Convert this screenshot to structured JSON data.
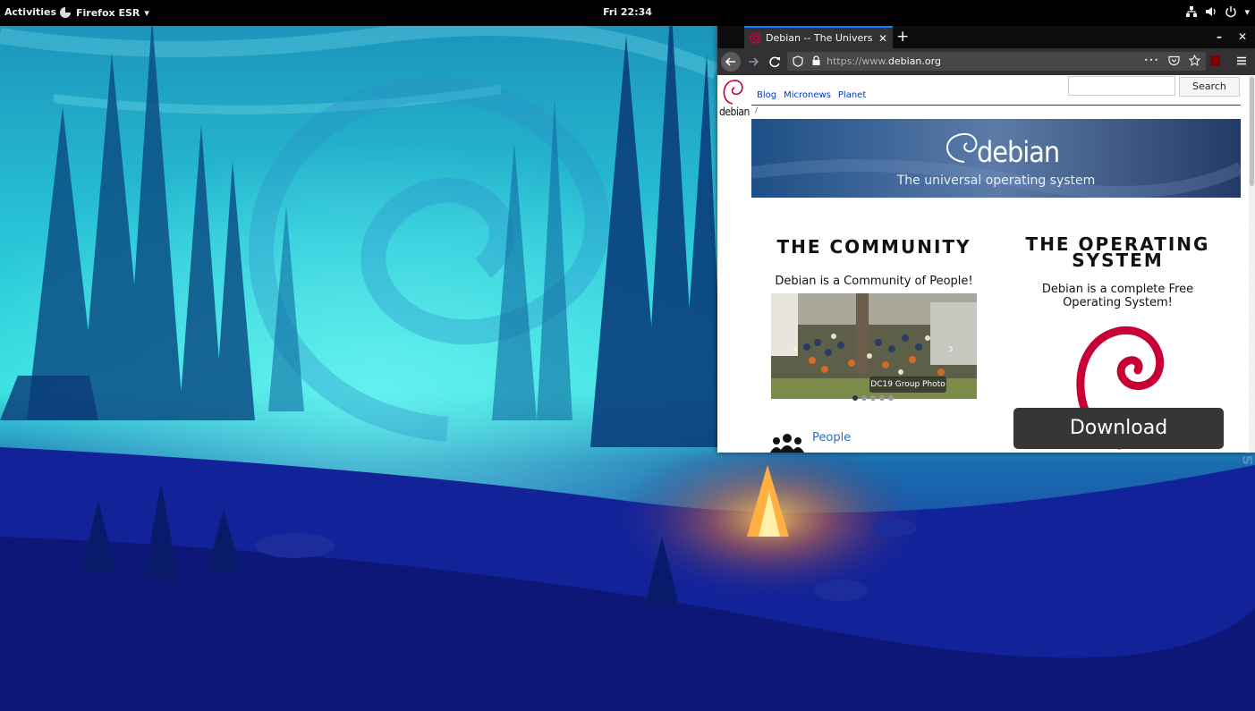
{
  "topbar": {
    "activities": "Activities",
    "app_menu": "Firefox ESR",
    "clock": "Fri 22:34"
  },
  "firefox": {
    "tab_title": "Debian -- The Universal Operating System",
    "url_prefix": "https://www.",
    "url_domain": "debian.org",
    "page_actions": "•••"
  },
  "page": {
    "logo_text": "debian",
    "nav_links": [
      "Blog",
      "Micronews",
      "Planet"
    ],
    "breadcrumb": "/",
    "search_placeholder": "",
    "search_button": "Search",
    "banner_word": "debian",
    "banner_tagline": "The universal operating system",
    "community_heading": "THE COMMUNITY",
    "community_text": "Debian is a Community of People!",
    "photo_caption": "DC19 Group Photo",
    "carousel_slides": 5,
    "carousel_active": 1,
    "os_heading_line1": "THE OPERATING",
    "os_heading_line2": "SYSTEM",
    "os_text_line1": "Debian is a complete Free",
    "os_text_line2": "Operating System!",
    "download": "Download",
    "people_link": "People"
  },
  "watermark": "screenshots.debian.net",
  "colors": {
    "debian_red": "#c70036",
    "topbar": "#000000",
    "firefox_chrome": "#323234",
    "firefox_accent": "#0a84ff",
    "link_blue": "#0035c7",
    "download_button": "#363636"
  },
  "icons": [
    "firefox-icon",
    "network-icon",
    "volume-icon",
    "power-icon",
    "debian-favicon",
    "back-icon",
    "forward-icon",
    "reload-icon",
    "shield-icon",
    "lock-icon",
    "pocket-icon",
    "bookmark-star-icon",
    "ublock-icon",
    "hamburger-menu-icon",
    "people-icon"
  ]
}
